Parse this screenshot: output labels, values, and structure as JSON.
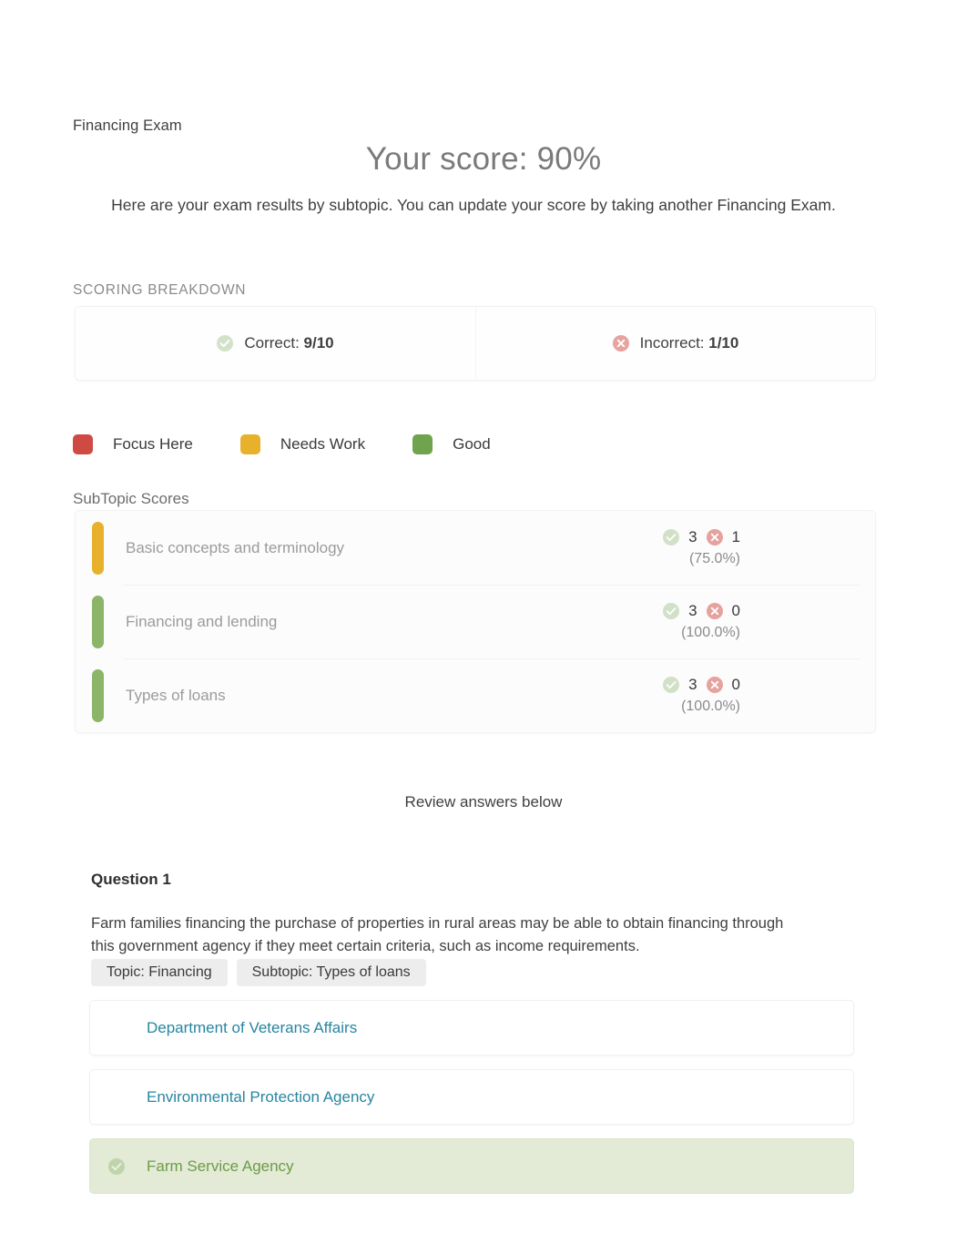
{
  "header": {
    "exam_label": "Financing Exam",
    "score_title": "Your score: 90%",
    "score_subtitle": "Here are your exam results by subtopic. You can update your score by taking another Financing Exam."
  },
  "scoring_breakdown": {
    "heading": "SCORING BREAKDOWN",
    "correct": {
      "icon": "check-circle-icon",
      "label": "Correct:",
      "value": "9/10"
    },
    "incorrect": {
      "icon": "x-circle-icon",
      "label": "Incorrect:",
      "value": "1/10"
    }
  },
  "legend": {
    "items": [
      {
        "label": "Focus Here",
        "color": "#cf4a42",
        "icon": "legend-swatch-red"
      },
      {
        "label": "Needs Work",
        "color": "#e8b12c",
        "icon": "legend-swatch-amber"
      },
      {
        "label": "Good",
        "color": "#6fa34d",
        "icon": "legend-swatch-green"
      }
    ]
  },
  "subtopic_scores": {
    "heading": "SubTopic Scores",
    "rows": [
      {
        "name": "Basic concepts and terminology",
        "bar_color": "#e8b12c",
        "status": "Needs Work",
        "correct": "3",
        "incorrect": "1",
        "percent": "(75.0%)"
      },
      {
        "name": "Financing and lending",
        "bar_color": "#8cb56a",
        "status": "Good",
        "correct": "3",
        "incorrect": "0",
        "percent": "(100.0%)"
      },
      {
        "name": "Types of loans",
        "bar_color": "#8cb56a",
        "status": "Good",
        "correct": "3",
        "incorrect": "0",
        "percent": "(100.0%)"
      }
    ]
  },
  "review": {
    "note": "Review answers below"
  },
  "question": {
    "title": "Question 1",
    "text": "Farm families financing the purchase of properties in rural areas may be able to obtain financing through this government agency if they meet certain criteria, such as income requirements.",
    "topic_tag": "Topic: Financing",
    "subtopic_tag": "Subtopic: Types of loans",
    "options": [
      {
        "label": "Department of Veterans Affairs",
        "correct": false
      },
      {
        "label": "Environmental Protection Agency",
        "correct": false
      },
      {
        "label": "Farm Service Agency",
        "correct": true,
        "icon": "check-circle-icon"
      }
    ]
  },
  "colors": {
    "link": "#2785a0",
    "correct_green": "#6e9b4a",
    "correct_bg": "#e3ead5",
    "incorrect_red": "#cf4a42"
  }
}
